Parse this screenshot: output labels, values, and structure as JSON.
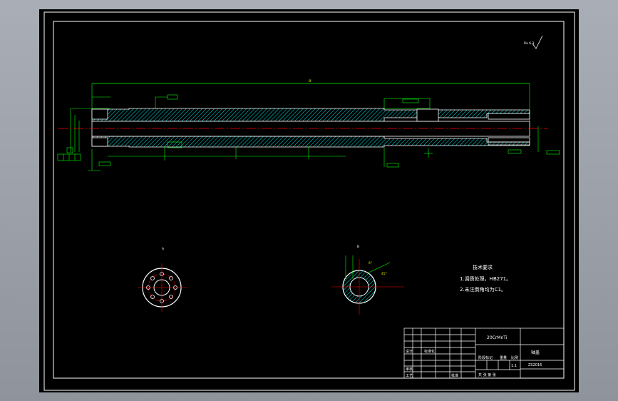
{
  "drawing": {
    "surface_roughness": "Ra 6.3",
    "overall_length_dim": "Ø",
    "technical_requirements": {
      "title": "技术要求",
      "items": [
        "1.调质处理，HB271。",
        "2.未注倒角均为C1。"
      ]
    },
    "section_views": {
      "flange_label": "A",
      "hole_label": "B",
      "angle_labels": [
        "6°",
        "45°"
      ]
    },
    "title_block": {
      "material": "20CrMnTi",
      "part_name": "轴盖",
      "drawing_no": "ZS2016",
      "scale": "1:1",
      "sheet": "共 张 第 张",
      "labels": {
        "designer": "设计",
        "checker": "审核",
        "standard": "标准化",
        "process": "工艺",
        "approve": "批准",
        "stage": "阶段标记",
        "weight": "重量",
        "ratio": "比例"
      }
    },
    "colors": {
      "background": "#000000",
      "outline": "#ffffff",
      "dimension": "#00ff00",
      "centerline": "#ff0000",
      "hatch": "#00e5e5",
      "frame": "#ffffff"
    }
  }
}
